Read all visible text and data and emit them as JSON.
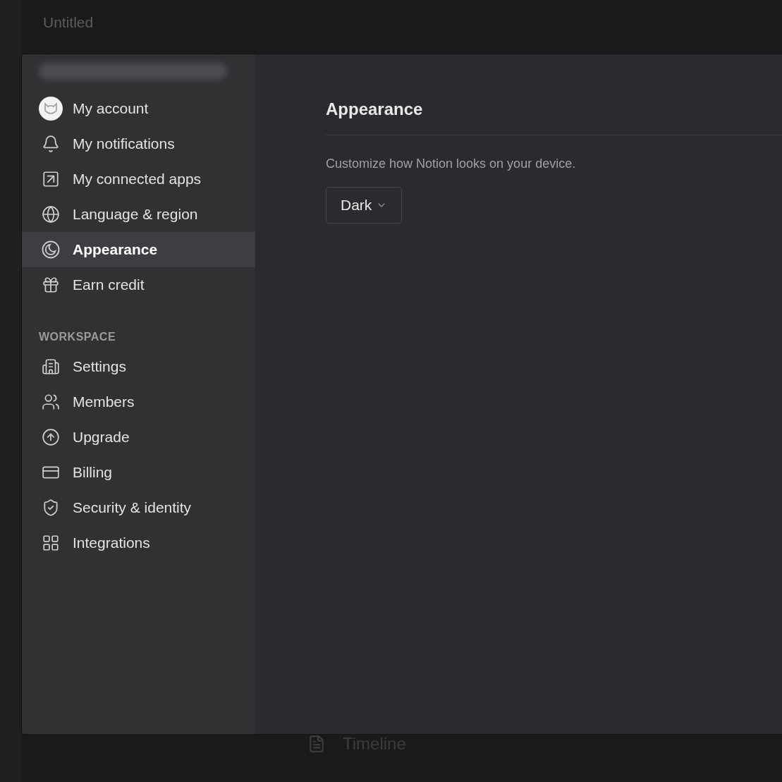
{
  "background": {
    "page_title": "Untitled",
    "hidden_item": "Timeline"
  },
  "settings": {
    "sidebar": {
      "sections": [
        {
          "items": [
            {
              "label": "My account",
              "selected": false
            },
            {
              "label": "My notifications",
              "selected": false
            },
            {
              "label": "My connected apps",
              "selected": false
            },
            {
              "label": "Language & region",
              "selected": false
            },
            {
              "label": "Appearance",
              "selected": true
            },
            {
              "label": "Earn credit",
              "selected": false
            }
          ]
        },
        {
          "heading": "WORKSPACE",
          "items": [
            {
              "label": "Settings",
              "selected": false
            },
            {
              "label": "Members",
              "selected": false
            },
            {
              "label": "Upgrade",
              "selected": false
            },
            {
              "label": "Billing",
              "selected": false
            },
            {
              "label": "Security & identity",
              "selected": false
            },
            {
              "label": "Integrations",
              "selected": false
            }
          ]
        }
      ]
    },
    "main": {
      "title": "Appearance",
      "description": "Customize how Notion looks on your device.",
      "theme_select": {
        "value": "Dark"
      }
    }
  }
}
